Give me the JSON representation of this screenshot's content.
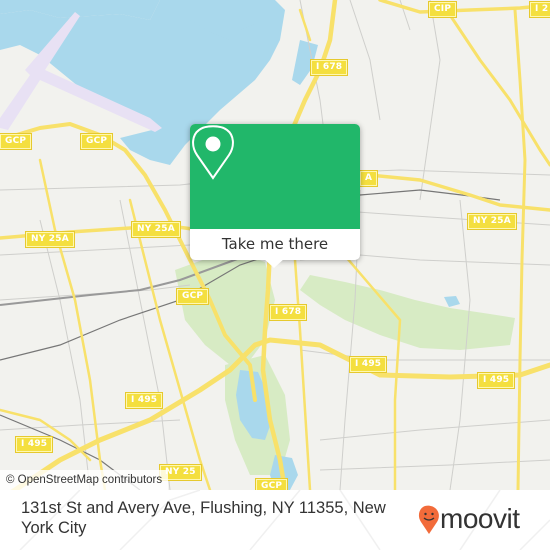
{
  "map": {
    "route_shields": [
      {
        "label": "GCP"
      },
      {
        "label": "GCP"
      },
      {
        "label": "CIP"
      },
      {
        "label": "I 678"
      },
      {
        "label": "NY 25A"
      },
      {
        "label": "NY 25A"
      },
      {
        "label": "NY 25A"
      },
      {
        "label": "GCP"
      },
      {
        "label": "I 678"
      },
      {
        "label": "I 495"
      },
      {
        "label": "I 495"
      },
      {
        "label": "I 495"
      },
      {
        "label": "I 495"
      },
      {
        "label": "NY 25"
      },
      {
        "label": "GCP"
      },
      {
        "label": "I 2"
      },
      {
        "label": "A"
      }
    ],
    "attribution": "© OpenStreetMap contributors",
    "colors": {
      "land": "#f2f2ee",
      "water": "#a9d8ec",
      "park": "#d7ebc4",
      "highway": "#f8e16a",
      "airport": "#e8e1f4"
    }
  },
  "popup": {
    "icon": "location-pin-icon",
    "button_label": "Take me there",
    "accent_color": "#21b76a"
  },
  "footer": {
    "address": "131st St and Avery Ave, Flushing, NY 11355, New York City",
    "brand": "moovit",
    "brand_color": "#f26b3a"
  }
}
